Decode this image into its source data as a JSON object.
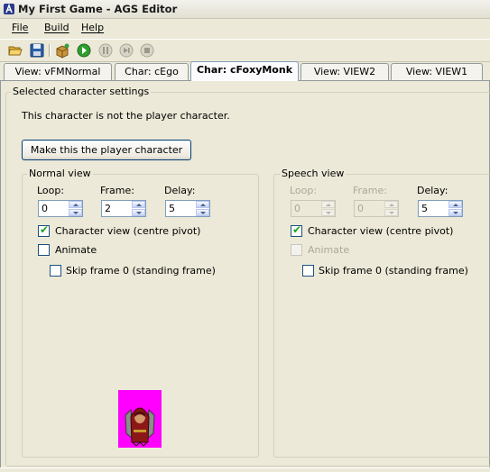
{
  "window": {
    "title": "My First Game - AGS Editor"
  },
  "menu": {
    "items": [
      {
        "label": "File",
        "mnemonic": "F"
      },
      {
        "label": "Build",
        "mnemonic": "B"
      },
      {
        "label": "Help",
        "mnemonic": "H"
      }
    ]
  },
  "toolbar": {
    "buttons": [
      "open-icon",
      "save-icon",
      "build-icon",
      "run-icon",
      "pause-icon",
      "step-icon",
      "stop-icon"
    ]
  },
  "tabs": [
    {
      "label": "View: vFMNormal",
      "active": false
    },
    {
      "label": "Char: cEgo",
      "active": false
    },
    {
      "label": "Char: cFoxyMonk",
      "active": true
    },
    {
      "label": "View: VIEW2",
      "active": false
    },
    {
      "label": "View: VIEW1",
      "active": false
    }
  ],
  "panel": {
    "group_title": "Selected character settings",
    "status_text": "This character is not the player character.",
    "make_player_button": "Make this the player character"
  },
  "normal_view": {
    "title": "Normal view",
    "loop_label": "Loop:",
    "frame_label": "Frame:",
    "delay_label": "Delay:",
    "loop_value": "0",
    "frame_value": "2",
    "delay_value": "5",
    "character_view_label": "Character view (centre pivot)",
    "character_view_checked": true,
    "animate_label": "Animate",
    "animate_checked": false,
    "skip_frame_label": "Skip frame 0 (standing frame)",
    "skip_frame_checked": false
  },
  "speech_view": {
    "title": "Speech view",
    "loop_label": "Loop:",
    "frame_label": "Frame:",
    "delay_label": "Delay:",
    "loop_value": "0",
    "frame_value": "0",
    "delay_value": "5",
    "character_view_label": "Character view (centre pivot)",
    "character_view_checked": true,
    "animate_label": "Animate",
    "animate_checked": false,
    "skip_frame_label": "Skip frame 0 (standing frame)",
    "skip_frame_checked": false
  },
  "colors": {
    "sprite_background": "#ff00ff",
    "window_background": "#ece9d8",
    "check_green": "#21a121"
  }
}
